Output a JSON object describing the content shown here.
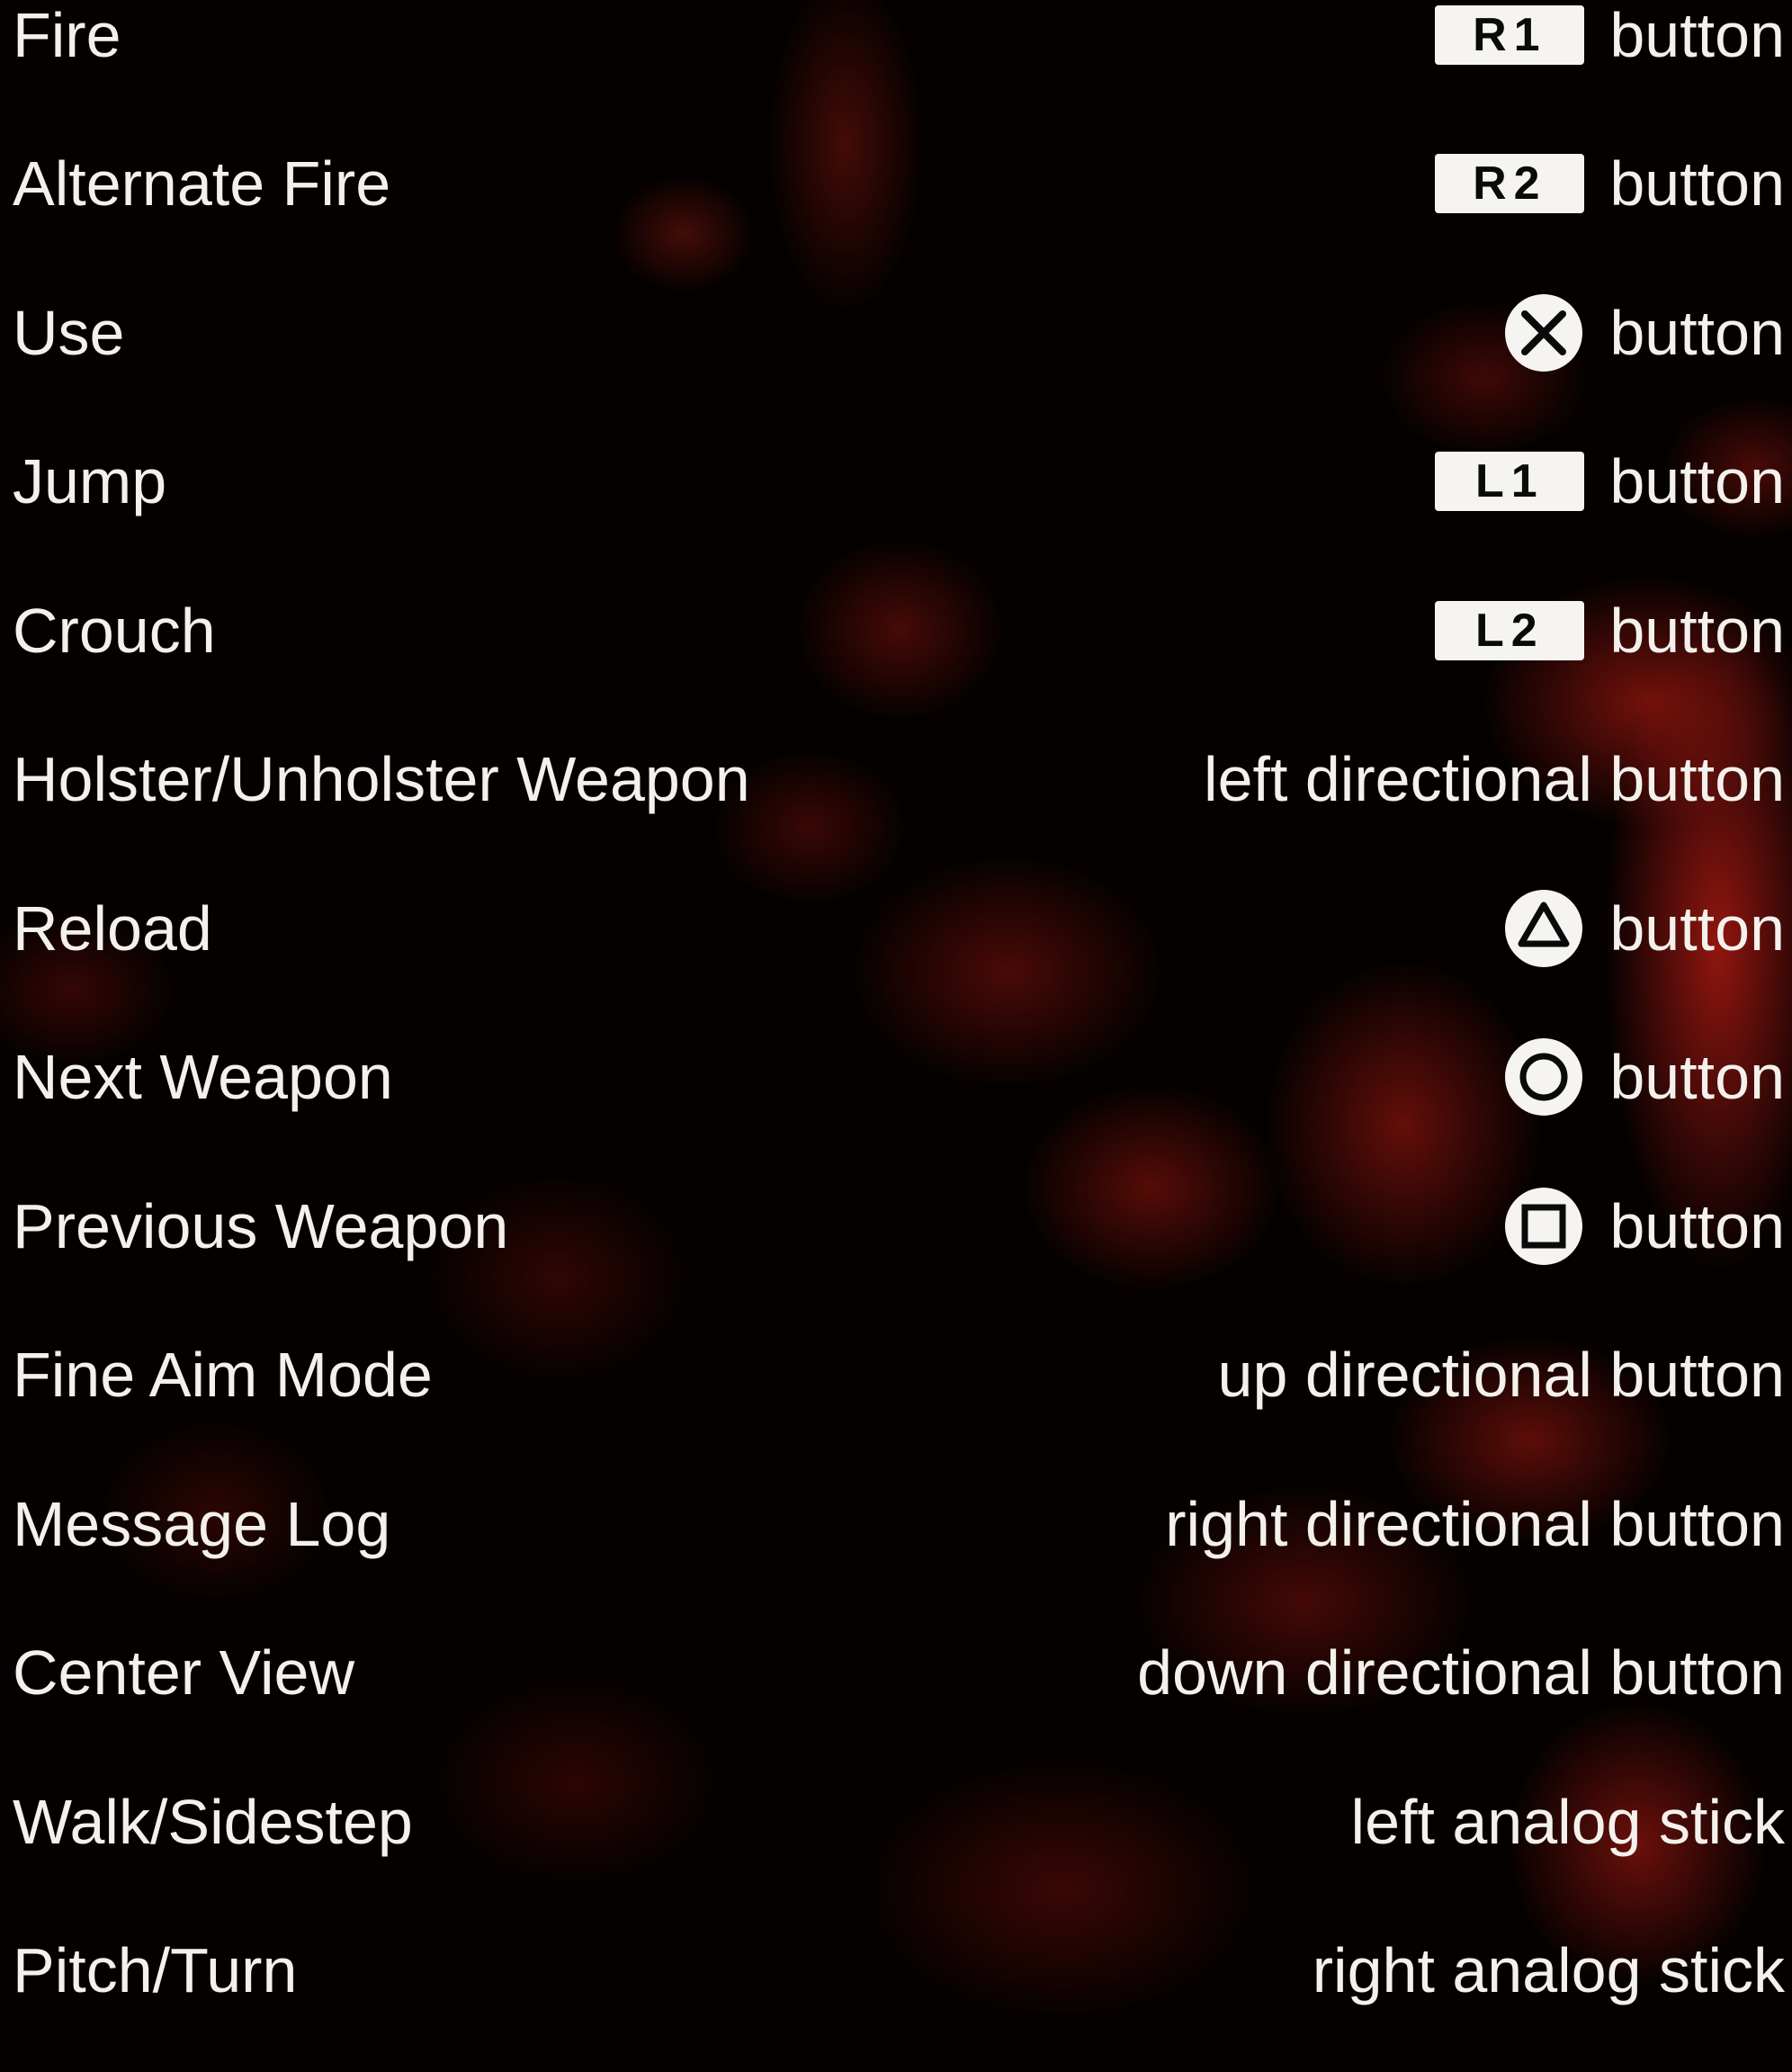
{
  "controls": [
    {
      "action": "Fire",
      "key": "R1",
      "binding": "button"
    },
    {
      "action": "Alternate Fire",
      "key": "R2",
      "binding": "button"
    },
    {
      "action": "Use",
      "symbol": "cross-icon",
      "binding": "button"
    },
    {
      "action": "Jump",
      "key": "L1",
      "binding": "button"
    },
    {
      "action": "Crouch",
      "key": "L2",
      "binding": "button"
    },
    {
      "action": "Holster/Unholster Weapon",
      "binding": "left directional button"
    },
    {
      "action": "Reload",
      "symbol": "triangle-icon",
      "binding": "button"
    },
    {
      "action": "Next Weapon",
      "symbol": "circle-icon",
      "binding": "button"
    },
    {
      "action": "Previous Weapon",
      "symbol": "square-icon",
      "binding": "button"
    },
    {
      "action": "Fine Aim Mode",
      "binding": "up directional button"
    },
    {
      "action": "Message Log",
      "binding": "right directional button"
    },
    {
      "action": "Center View",
      "binding": "down directional button"
    },
    {
      "action": "Walk/Sidestep",
      "binding": "left analog stick"
    },
    {
      "action": "Pitch/Turn",
      "binding": "right analog stick"
    }
  ],
  "colors": {
    "text": "#f4f1ec",
    "background": "#050101",
    "texture": "#a0180f"
  }
}
